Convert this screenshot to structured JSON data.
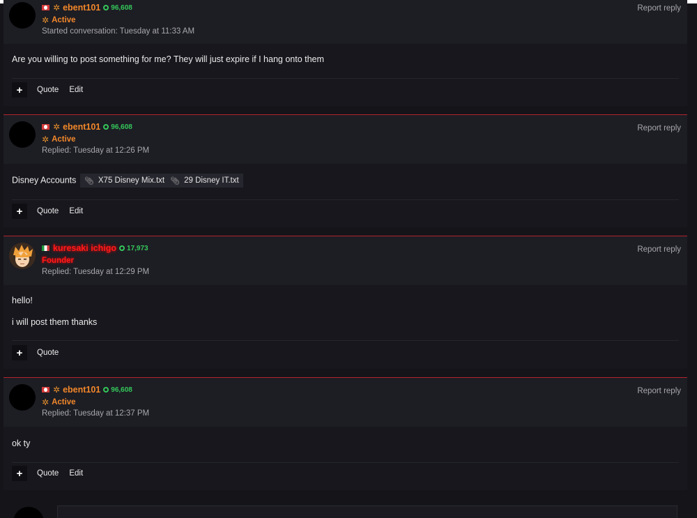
{
  "posts": [
    {
      "user": "ebent101",
      "reputation": "96,608",
      "status": "Active",
      "date": "Started conversation: Tuesday at 11:33 AM",
      "report": "Report reply",
      "lines": [
        "Are you willing to post something for me? They will just expire if I hang onto them"
      ],
      "actions": {
        "quote": "Quote",
        "edit": "Edit"
      }
    },
    {
      "user": "ebent101",
      "reputation": "96,608",
      "status": "Active",
      "date": "Replied: Tuesday at 12:26 PM",
      "report": "Report reply",
      "lines": [
        "Disney Accounts"
      ],
      "attachments": [
        "X75 Disney Mix.txt",
        "29 Disney IT.txt"
      ],
      "actions": {
        "quote": "Quote",
        "edit": "Edit"
      }
    },
    {
      "user": "kuresaki ichigo",
      "reputation": "17,973",
      "status": "Founder",
      "date": "Replied: Tuesday at 12:29 PM",
      "report": "Report reply",
      "lines": [
        "hello!",
        "i will post them thanks"
      ],
      "actions": {
        "quote": "Quote"
      }
    },
    {
      "user": "ebent101",
      "reputation": "96,608",
      "status": "Active",
      "date": "Replied: Tuesday at 12:37 PM",
      "report": "Report reply",
      "lines": [
        "ok ty"
      ],
      "actions": {
        "quote": "Quote",
        "edit": "Edit"
      }
    }
  ],
  "icons": {
    "plus": "plus-icon",
    "rank": "star-badge-icon",
    "reputation": "reputation-circle-icon",
    "attachment": "paperclip-icon"
  },
  "colors": {
    "accent_border": "#b3242e",
    "username_orange": "#f2882a",
    "username_red": "#ff1a1a",
    "reputation_green": "#34c85a"
  }
}
